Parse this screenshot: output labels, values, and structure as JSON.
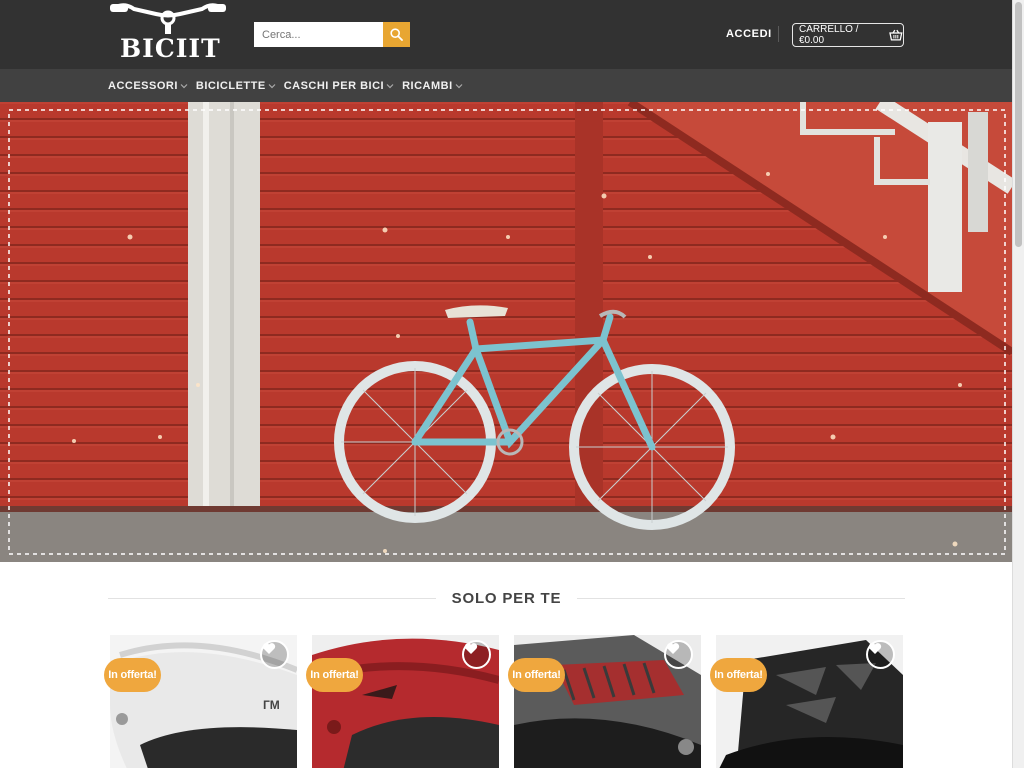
{
  "brand": {
    "name": "BICIIT"
  },
  "search": {
    "placeholder": "Cerca..."
  },
  "header": {
    "login_label": "ACCEDI",
    "cart_label": "CARRELLO / €0.00"
  },
  "nav": {
    "items": [
      {
        "label": "ACCESSORI"
      },
      {
        "label": "BICICLETTE"
      },
      {
        "label": "CASCHI PER BICI"
      },
      {
        "label": "RICAMBI"
      }
    ]
  },
  "section": {
    "title": "SOLO PER TE"
  },
  "products": [
    {
      "badge": "In offerta!",
      "helmet_color": "white"
    },
    {
      "badge": "In offerta!",
      "helmet_color": "red"
    },
    {
      "badge": "In offerta!",
      "helmet_color": "grey-red"
    },
    {
      "badge": "In offerta!",
      "helmet_color": "black"
    }
  ],
  "colors": {
    "topbar": "#323232",
    "navbar": "#414141",
    "accent": "#e8a632",
    "badge": "#efa73e"
  },
  "icons": {
    "search": "search-icon",
    "cart": "basket-icon",
    "wishlist": "heart-icon",
    "dropdown": "chevron-down-icon"
  }
}
